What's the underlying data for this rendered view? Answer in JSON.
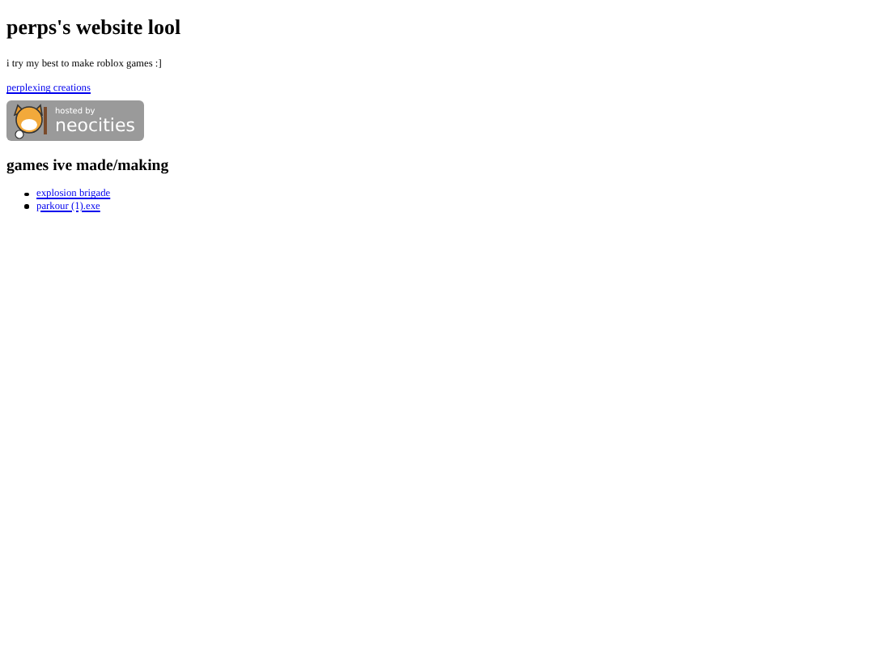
{
  "title": "perps's website lool",
  "intro": "i try my best to make roblox games :]",
  "link": "perplexing creations",
  "badge": {
    "line_1": "hosted by",
    "line_2": "neocities"
  },
  "section_heading": "games ive made/making",
  "games": [
    {
      "label": "explosion brigade"
    },
    {
      "label": "parkour (1).exe"
    }
  ]
}
